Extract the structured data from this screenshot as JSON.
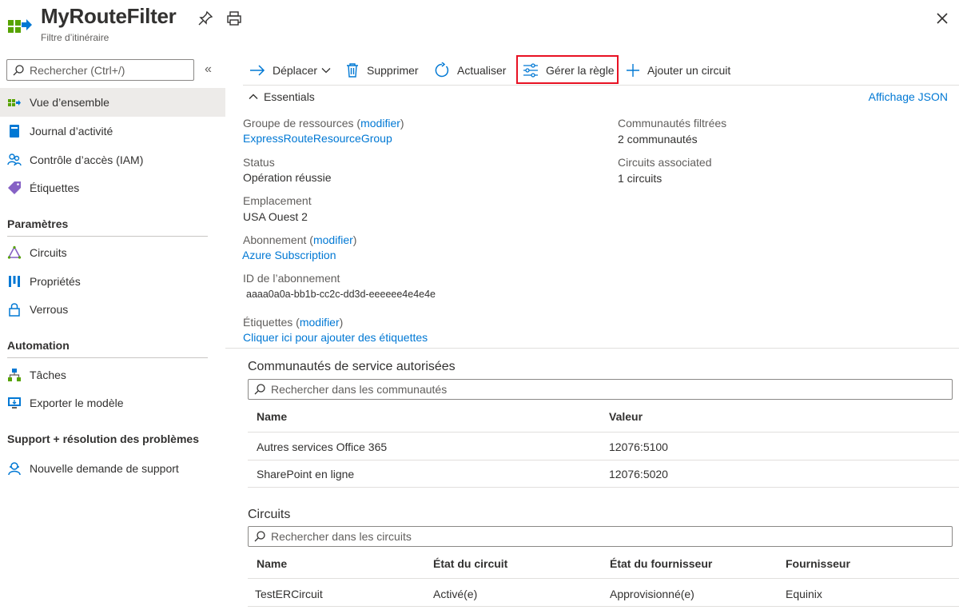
{
  "header": {
    "title": "MyRouteFilter",
    "subtitle": "Filtre d’itinéraire",
    "icon": "route-filter-icon"
  },
  "sidebar": {
    "search_placeholder": "Rechercher (Ctrl+/)",
    "items": [
      {
        "label": "Vue d’ensemble",
        "icon": "overview-icon",
        "active": true
      },
      {
        "label": "Journal d’activité",
        "icon": "activity-log-icon"
      },
      {
        "label": "Contrôle d’accès (IAM)",
        "icon": "iam-icon"
      },
      {
        "label": "Étiquettes",
        "icon": "tag-icon"
      }
    ],
    "groups": [
      {
        "title": "Paramètres",
        "items": [
          {
            "label": "Circuits",
            "icon": "circuits-icon"
          },
          {
            "label": "Propriétés",
            "icon": "properties-icon"
          },
          {
            "label": "Verrous",
            "icon": "lock-icon"
          }
        ]
      },
      {
        "title": "Automation",
        "items": [
          {
            "label": "Tâches",
            "icon": "tasks-icon"
          },
          {
            "label": "Exporter le modèle",
            "icon": "export-template-icon"
          }
        ]
      },
      {
        "title": "Support + résolution des problèmes",
        "items": [
          {
            "label": "Nouvelle demande de support",
            "icon": "support-icon"
          }
        ]
      }
    ]
  },
  "toolbar": {
    "move": "Déplacer",
    "delete": "Supprimer",
    "refresh": "Actualiser",
    "manage_rule": "Gérer la règle",
    "add_circuit": "Ajouter un circuit"
  },
  "essentials": {
    "toggle_label": "Essentials",
    "json_view": "Affichage JSON",
    "modify": "modifier",
    "left": {
      "resource_group_label": "Groupe de ressources",
      "resource_group_value": "ExpressRouteResourceGroup",
      "status_label": "Status",
      "status_value": "Opération réussie",
      "location_label": "Emplacement",
      "location_value": "USA Ouest 2",
      "subscription_label": "Abonnement",
      "subscription_value": "Azure Subscription",
      "subscription_id_label": "ID de l’abonnement",
      "subscription_id_value": "aaaa0a0a-bb1b-cc2c-dd3d-eeeeee4e4e4e",
      "tags_label": "Étiquettes",
      "tags_value": "Cliquer ici pour ajouter des étiquettes"
    },
    "right": {
      "communities_label": "Communautés filtrées",
      "communities_value": "2 communautés",
      "circuits_label": "Circuits associated",
      "circuits_value": "1 circuits"
    }
  },
  "communities": {
    "title": "Communautés de service autorisées",
    "search_placeholder": "Rechercher dans les communautés",
    "columns": [
      "Name",
      "Valeur"
    ],
    "rows": [
      [
        "Autres services Office 365",
        "12076:5100"
      ],
      [
        "SharePoint en ligne",
        "12076:5020"
      ]
    ]
  },
  "circuits": {
    "title": "Circuits",
    "search_placeholder": "Rechercher dans les circuits",
    "columns": [
      "Name",
      "État du circuit",
      "État du fournisseur",
      "Fournisseur"
    ],
    "rows": [
      [
        "TestERCircuit",
        "Activé(e)",
        "Approvisionné(e)",
        "Equinix"
      ]
    ]
  },
  "colors": {
    "accent": "#0078d4",
    "highlight_border": "#e81123",
    "active_bg": "#edebe9"
  }
}
